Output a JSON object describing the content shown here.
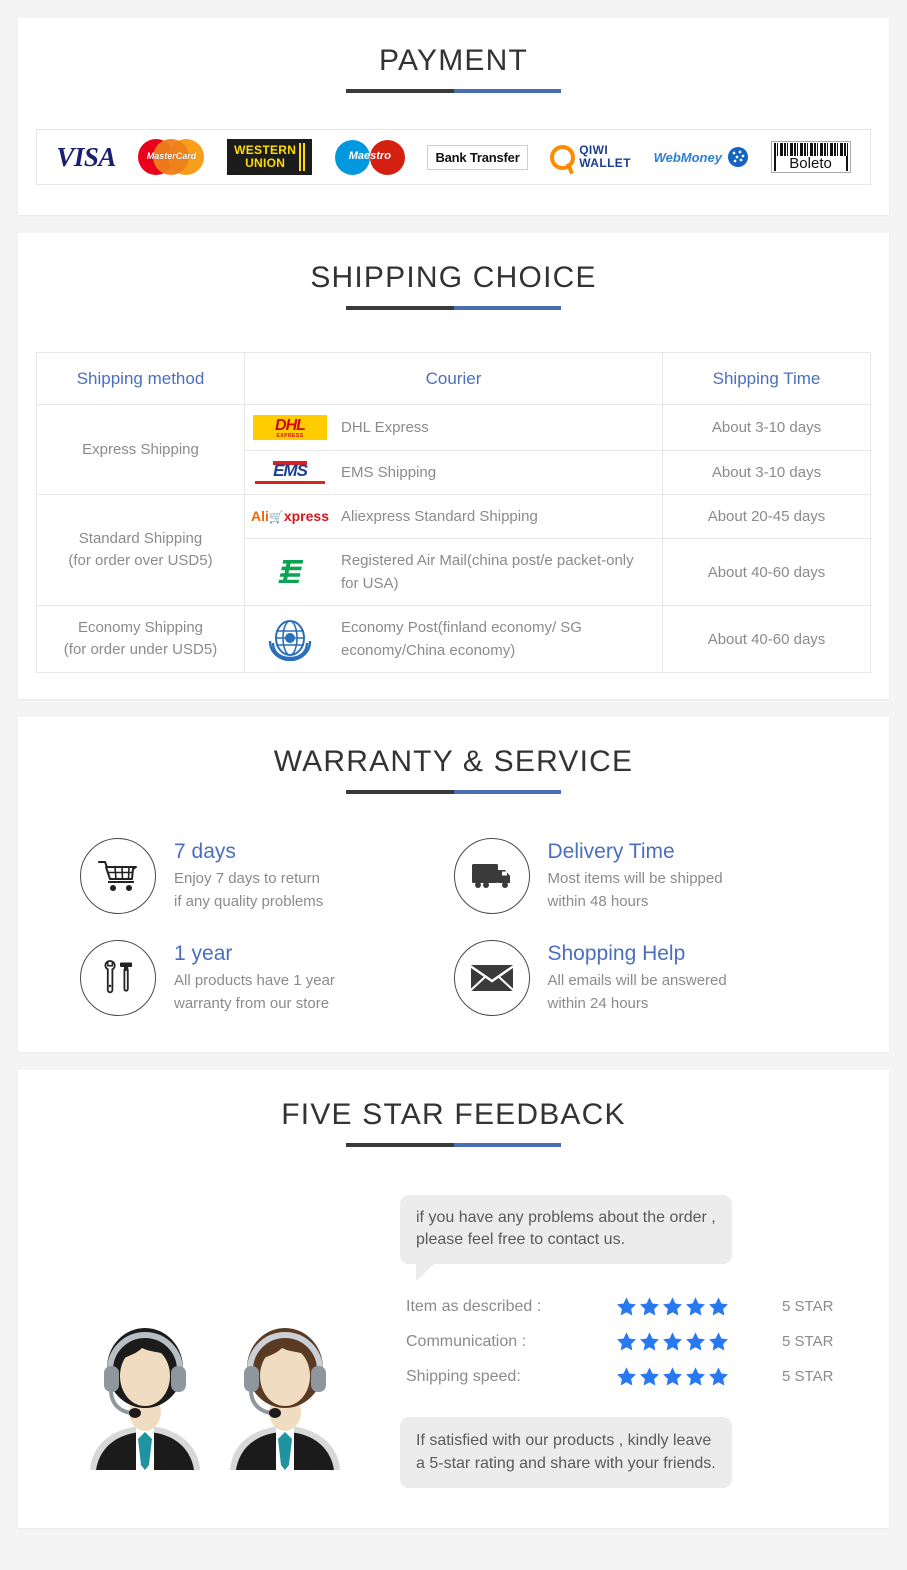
{
  "sections": {
    "payment": {
      "title": "PAYMENT",
      "methods": [
        {
          "name": "visa-logo",
          "label": "VISA"
        },
        {
          "name": "mastercard-logo",
          "label": "MasterCard"
        },
        {
          "name": "western-union-logo",
          "label_line1": "WESTERN",
          "label_line2": "UNION"
        },
        {
          "name": "maestro-logo",
          "label": "Maestro"
        },
        {
          "name": "bank-transfer-logo",
          "label": "Bank Transfer"
        },
        {
          "name": "qiwi-wallet-logo",
          "label_line1": "QIWI",
          "label_line2": "WALLET"
        },
        {
          "name": "webmoney-logo",
          "label": "WebMoney"
        },
        {
          "name": "boleto-logo",
          "label": "Boleto"
        }
      ]
    },
    "shipping": {
      "title": "SHIPPING CHOICE",
      "columns": [
        "Shipping method",
        "Courier",
        "Shipping Time"
      ],
      "rows": [
        {
          "method": "Express Shipping",
          "method_line2": "",
          "entries": [
            {
              "logo": "dhl-logo",
              "logo_text": "DHL",
              "logo_sub": "EXPRESS",
              "courier": "DHL Express",
              "time": "About 3-10 days"
            },
            {
              "logo": "ems-logo",
              "logo_text": "EMS",
              "logo_sub": "",
              "courier": "EMS Shipping",
              "time": "About 3-10 days"
            }
          ]
        },
        {
          "method": "Standard Shipping",
          "method_line2": "(for order over USD5)",
          "entries": [
            {
              "logo": "aliexpress-logo",
              "logo_text": "AliExpress",
              "logo_sub": "",
              "courier": "Aliexpress Standard Shipping",
              "time": "About 20-45 days"
            },
            {
              "logo": "china-post-logo",
              "logo_text": "",
              "logo_sub": "",
              "courier": "Registered Air Mail(china post/e packet-only for USA)",
              "time": "About 40-60 days"
            }
          ]
        },
        {
          "method": "Economy Shipping",
          "method_line2": "(for order under USD5)",
          "entries": [
            {
              "logo": "un-post-logo",
              "logo_text": "",
              "logo_sub": "",
              "courier": "Economy Post(finland economy/ SG economy/China economy)",
              "time": "About 40-60 days"
            }
          ]
        }
      ]
    },
    "warranty": {
      "title": "WARRANTY & SERVICE",
      "items": [
        {
          "icon": "shopping-cart-icon",
          "title": "7 days",
          "desc_line1": "Enjoy 7 days to return",
          "desc_line2": "if any quality problems"
        },
        {
          "icon": "delivery-truck-icon",
          "title": "Delivery Time",
          "desc_line1": "Most items will be shipped",
          "desc_line2": "within 48 hours"
        },
        {
          "icon": "tools-icon",
          "title": "1 year",
          "desc_line1": "All products have 1 year",
          "desc_line2": "warranty from our store"
        },
        {
          "icon": "envelope-icon",
          "title": "Shopping Help",
          "desc_line1": "All emails will be answered",
          "desc_line2": "within 24 hours"
        }
      ]
    },
    "feedback": {
      "title": "FIVE STAR FEEDBACK",
      "bubble_top_line1": "if you have any problems about the order ,",
      "bubble_top_line2": "please feel free to contact us.",
      "ratings": [
        {
          "label": "Item as described :",
          "stars": 5,
          "value": "5 STAR"
        },
        {
          "label": "Communication :",
          "stars": 5,
          "value": "5 STAR"
        },
        {
          "label": "Shipping speed:",
          "stars": 5,
          "value": "5 STAR"
        }
      ],
      "bubble_bottom_line1": "If satisfied with our products ,  kindly leave",
      "bubble_bottom_line2": "a 5-star rating and share with your friends.",
      "illustration": "customer-service-agents-illustration"
    }
  },
  "colors": {
    "accent_blue": "#4a6fc0",
    "rule_dark": "#3a3a3a",
    "rule_blue": "#4a6cb3",
    "body_text": "#8b8b8b",
    "star_blue": "#2878f0",
    "page_bg": "#f4f4f4"
  }
}
